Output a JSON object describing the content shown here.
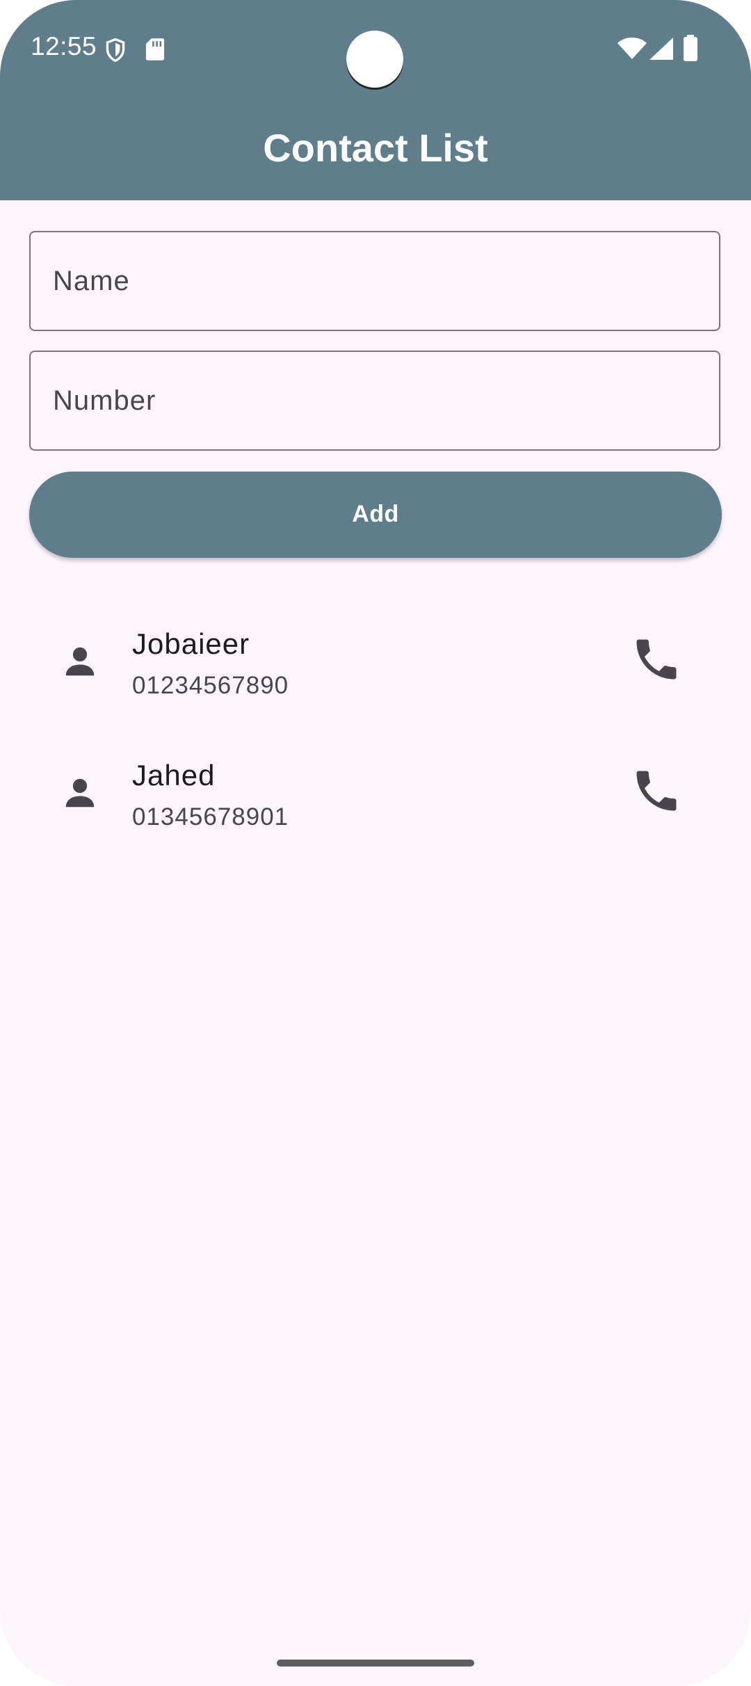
{
  "status_bar": {
    "time": "12:55"
  },
  "app_bar": {
    "title": "Contact List",
    "background_color": "#607D8B"
  },
  "form": {
    "name_field": {
      "label": "Name",
      "value": ""
    },
    "number_field": {
      "label": "Number",
      "value": ""
    },
    "add_button_label": "Add"
  },
  "contacts": [
    {
      "name": "Jobaieer",
      "number": "01234567890",
      "leading_icon": "person-icon",
      "trailing_icon": "phone-icon"
    },
    {
      "name": "Jahed",
      "number": "01345678901",
      "leading_icon": "person-icon",
      "trailing_icon": "phone-icon"
    }
  ],
  "colors": {
    "accent": "#607D8B",
    "background": "#FDF5FC",
    "icon": "#49454F"
  }
}
